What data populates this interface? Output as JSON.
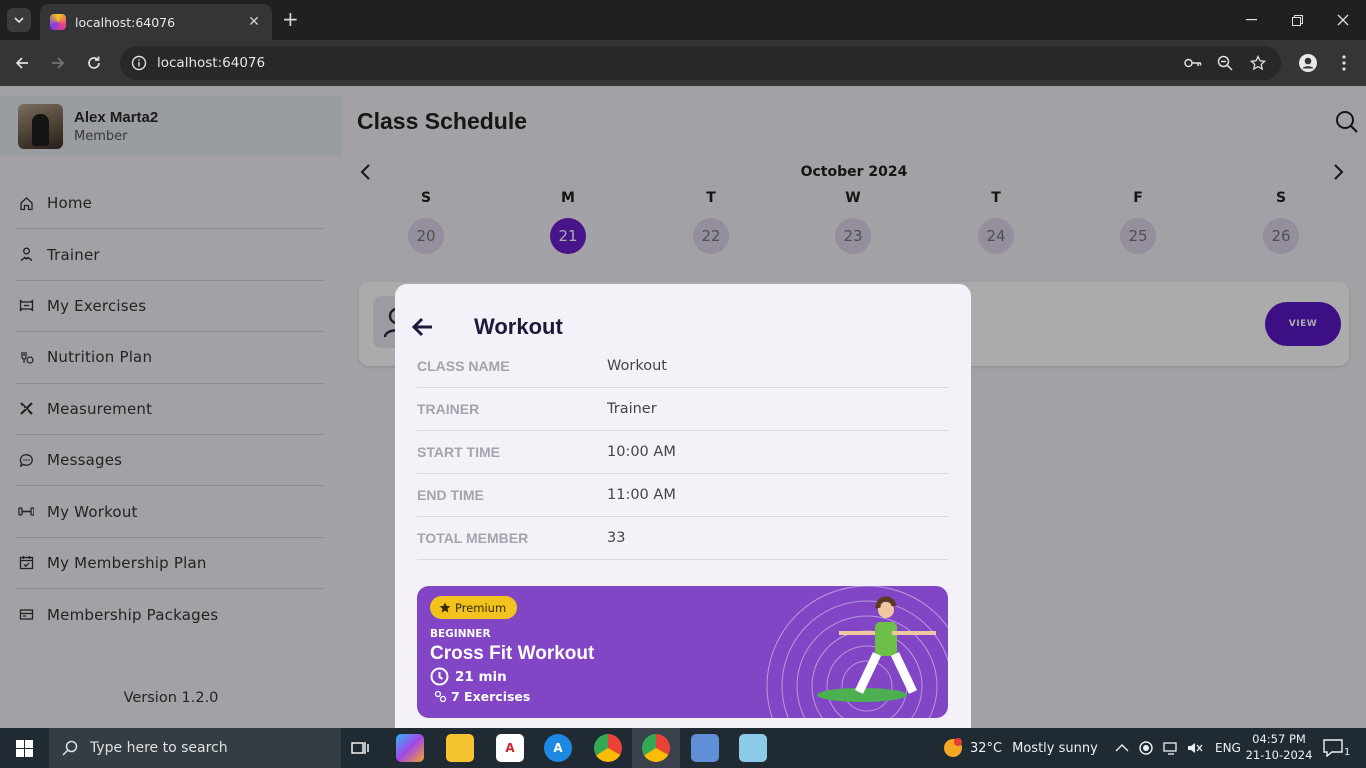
{
  "browser": {
    "tab_title": "localhost:64076",
    "url": "localhost:64076"
  },
  "sidebar": {
    "user_name": "Alex Marta2",
    "user_role": "Member",
    "items": [
      {
        "label": "Home",
        "icon": "home-icon"
      },
      {
        "label": "Trainer",
        "icon": "trainer-icon"
      },
      {
        "label": "My Exercises",
        "icon": "exercise-icon"
      },
      {
        "label": "Nutrition Plan",
        "icon": "nutrition-icon"
      },
      {
        "label": "Measurement",
        "icon": "measurement-icon"
      },
      {
        "label": "Messages",
        "icon": "messages-icon"
      },
      {
        "label": "My Workout",
        "icon": "dumbbell-icon"
      },
      {
        "label": "My Membership Plan",
        "icon": "calendar-icon"
      },
      {
        "label": "Membership Packages",
        "icon": "package-icon"
      }
    ],
    "version": "Version 1.2.0"
  },
  "page": {
    "title": "Class Schedule"
  },
  "calendar": {
    "month": "October 2024",
    "days": [
      {
        "day": "S",
        "date": "20"
      },
      {
        "day": "M",
        "date": "21",
        "selected": true
      },
      {
        "day": "T",
        "date": "22"
      },
      {
        "day": "W",
        "date": "23"
      },
      {
        "day": "T",
        "date": "24"
      },
      {
        "day": "F",
        "date": "25"
      },
      {
        "day": "S",
        "date": "26"
      }
    ]
  },
  "class_card": {
    "view_label": "VIEW"
  },
  "modal": {
    "title": "Workout",
    "rows": [
      {
        "key": "CLASS NAME",
        "value": "Workout"
      },
      {
        "key": "TRAINER",
        "value": "Trainer"
      },
      {
        "key": "START TIME",
        "value": "10:00 AM"
      },
      {
        "key": "END TIME",
        "value": "11:00 AM"
      },
      {
        "key": "TOTAL MEMBER",
        "value": "33"
      }
    ],
    "banner": {
      "badge": "Premium",
      "level": "BEGINNER",
      "name": "Cross Fit Workout",
      "duration": "21 min",
      "exercises": "7 Exercises",
      "color": "#8245c5"
    }
  },
  "taskbar": {
    "search_placeholder": "Type here to search",
    "weather_temp": "32°C",
    "weather_text": "Mostly sunny",
    "lang": "ENG",
    "time": "04:57 PM",
    "date": "21-10-2024",
    "notif_count": "1"
  },
  "colors": {
    "accent": "#6a1fd0",
    "view_button": "#5a17c7",
    "premium_badge": "#f2c31c"
  }
}
